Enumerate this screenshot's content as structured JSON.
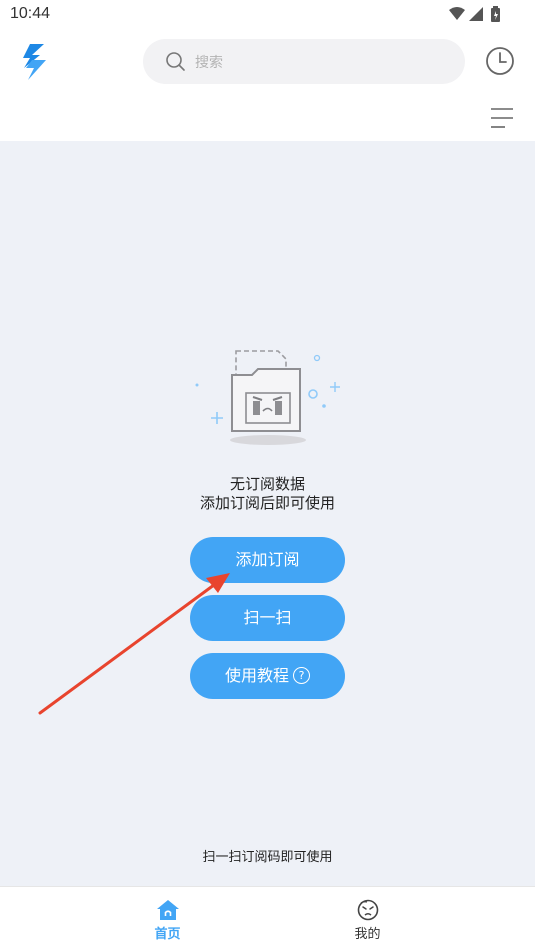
{
  "status_bar": {
    "time": "10:44",
    "icons": [
      "wifi-icon",
      "signal-icon",
      "battery-icon"
    ]
  },
  "header": {
    "logo": "lightning-logo-icon",
    "search_placeholder": "搜索",
    "history_icon": "clock-icon",
    "menu_icon": "menu-icon"
  },
  "empty_state": {
    "illustration": "sad-folder-illustration",
    "title": "无订阅数据",
    "subtitle": "添加订阅后即可使用"
  },
  "buttons": {
    "add_subscription": "添加订阅",
    "scan": "扫一扫",
    "tutorial": "使用教程",
    "tutorial_help": "?"
  },
  "footer_hint": "扫一扫订阅码即可使用",
  "tabbar": {
    "tabs": [
      {
        "label": "首页",
        "icon": "home-icon",
        "active": true
      },
      {
        "label": "我的",
        "icon": "face-icon",
        "active": false
      }
    ]
  },
  "colors": {
    "accent": "#42a5f5",
    "background": "#eef1f7",
    "arrow": "#e8442e"
  }
}
